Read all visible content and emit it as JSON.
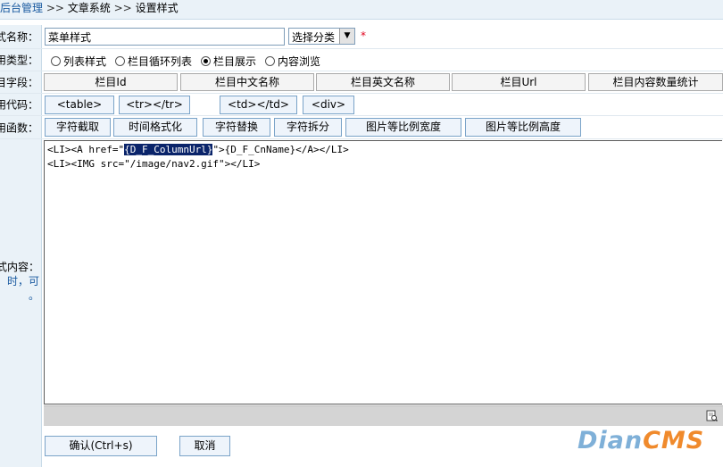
{
  "breadcrumb": {
    "home": "后台管理",
    "sep1": ">>",
    "module": "文章系统",
    "sep2": ">>",
    "page": "设置样式"
  },
  "form": {
    "name_label": "式名称：",
    "name_value": "菜单样式",
    "category_select": "选择分类",
    "required_mark": "*",
    "type_label": "用类型：",
    "types": [
      {
        "label": "列表样式",
        "checked": false
      },
      {
        "label": "栏目循环列表",
        "checked": false
      },
      {
        "label": "栏目展示",
        "checked": true
      },
      {
        "label": "内容浏览",
        "checked": false
      }
    ],
    "fields_label": "目字段：",
    "fields": [
      "栏目Id",
      "栏目中文名称",
      "栏目英文名称",
      "栏目Url",
      "栏目内容数量统计"
    ],
    "code_label": "用代码：",
    "codes": [
      "<table>",
      "<tr></tr>",
      "<td></td>",
      "<div>"
    ],
    "func_label": "用函数：",
    "funcs": [
      "字符截取",
      "时间格式化",
      "字符替换",
      "字符拆分",
      "图片等比例宽度",
      "图片等比例高度"
    ],
    "content_label": "式内容：",
    "content_hint1": "时，可",
    "content_hint2": "。",
    "editor": {
      "line1_pre": "<LI><A href=\"",
      "line1_sel": "{D_F_ColumnUrl}",
      "line1_post": "\">{D_F_CnName}</A></LI>",
      "line2": "<LI><IMG src=\"/image/nav2.gif\"></LI>"
    },
    "submit_label": "确认(Ctrl+s)",
    "cancel_label": "取消"
  },
  "logo": {
    "part1": "Dian",
    "part2": "CMS"
  },
  "colors": {
    "accent": "#1a5aa0",
    "label_bg": "#eaf2f8",
    "button_bg": "#eef4fb",
    "required": "#e0001b",
    "logo_blue": "#7fb0d8",
    "logo_orange": "#f08a2c"
  },
  "icons": {
    "resize": "resize-icon",
    "dropdown": "chevron-down-icon"
  }
}
